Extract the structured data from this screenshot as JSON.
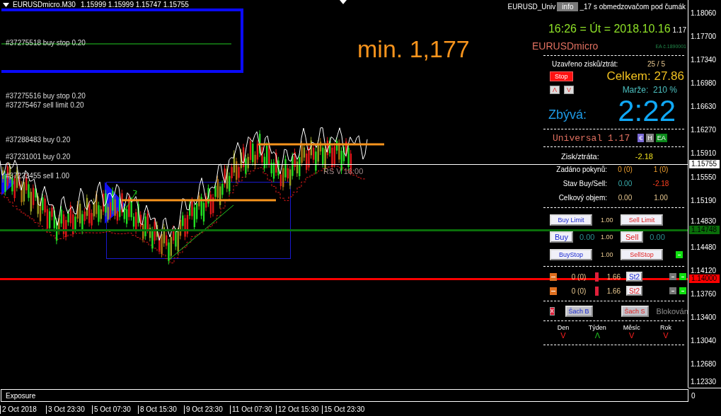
{
  "chart_header": {
    "symbol": "EURUSDmicro.M30",
    "prices": "1.15999 1.15999 1.15747 1.15755"
  },
  "order_labels": [
    {
      "text": "#37275518 buy stop 0.20"
    },
    {
      "text": "#37275516 buy stop 0.20"
    },
    {
      "text": "#37275467 sell limit 0.20"
    },
    {
      "text": "#37288483 buy 0.20"
    },
    {
      "text": "#37231001 buy 0.20"
    },
    {
      "text": "#37223455 sell 1.00"
    }
  ],
  "annotation": "min. 1,177",
  "signal_label": "RS V 16:00",
  "panel": {
    "title_left": "EURUSD_Univ",
    "info_button": "info",
    "title_right": "_17 s obmedzovačom pod čumák",
    "datetime": "16:26 = Út = 2018.10.16",
    "version_small": "1.17",
    "symbol": "EURUSDmicro",
    "ea_number": "EA č.1890001",
    "closed_label": "Uzavřeno zisků/ztrát:",
    "closed_value": "25 / 5",
    "stop_button": "Stop",
    "total": "Celkem: 27.86",
    "up_button": "Λ",
    "down_button": "V",
    "margin": "Marže:  210 %",
    "remaining_label": "Zbývá:",
    "remaining_time": "2:22",
    "product": "Universal 1.17",
    "badges": [
      {
        "text": "€",
        "color": "#7a6ad6"
      },
      {
        "text": "H",
        "color": "#808080"
      },
      {
        "text": "EA",
        "color": "#0c8a1c"
      }
    ],
    "profit_label": "Zisk/ztráta:",
    "profit_value": "-2.18",
    "stats": [
      {
        "label": "Zadáno pokynů:",
        "buy": "0 (0)",
        "sell": "1 (0)",
        "kind": "orders"
      },
      {
        "label": "Stav Buy/Sell:",
        "buy": "0.00",
        "sell": "-2.18",
        "kind": "state"
      },
      {
        "label": "Celkový objem:",
        "buy": "0.00",
        "sell": "1.00",
        "kind": "volume"
      }
    ],
    "order_rows": [
      {
        "buy": "Buy Limit",
        "lot": "1.00",
        "sell": "Sell Limit"
      },
      {
        "buy": "Buy",
        "buy_value": "0.00",
        "lot": "1.00",
        "sell": "Sell",
        "sell_value": "0.00"
      },
      {
        "buy": "BuyStop",
        "lot": "1.00",
        "sell": "SellStop",
        "toggle": true
      }
    ],
    "stop_rows": [
      {
        "count": "0 (0)",
        "value": "1.66",
        "button": "St2",
        "kind": "buy",
        "switches": [
          false,
          true
        ]
      },
      {
        "count": "0 (0)",
        "value": "1.66",
        "button": "St2",
        "kind": "sell",
        "switches": [
          false,
          true
        ]
      }
    ],
    "hedge_row": {
      "close_button": "x",
      "buy": "Šach B",
      "sell": "Šach S",
      "status": "Blokován"
    },
    "periods": [
      {
        "label": "Den",
        "arrow": "V",
        "kind": "down"
      },
      {
        "label": "Týden",
        "arrow": "Λ",
        "kind": "up"
      },
      {
        "label": "Měsíc",
        "arrow": "V",
        "kind": "down"
      },
      {
        "label": "Rok",
        "arrow": "V",
        "kind": "down"
      }
    ]
  },
  "price_axis": {
    "ticks": [
      "1.18060",
      "1.17700",
      "1.17340",
      "1.16980",
      "1.16630",
      "1.16270",
      "1.15910",
      "1.15550",
      "1.15190",
      "1.14830",
      "1.14480",
      "1.14120",
      "1.13760",
      "1.13400",
      "1.13040",
      "1.12680",
      "1.12330"
    ],
    "markers": [
      {
        "label": "1.15755",
        "kind": "bid"
      },
      {
        "label": "1.14748",
        "kind": "level",
        "color": "#0a6e0a"
      },
      {
        "label": "1.14000",
        "kind": "level",
        "color": "#ff0000"
      }
    ]
  },
  "subwindow": {
    "title": "Exposure",
    "scale": "0"
  },
  "time_axis": [
    "2 Oct 2018",
    "3 Oct 23:30",
    "5 Oct 07:30",
    "8 Oct 15:30",
    "9 Oct 23:30",
    "11 Oct 07:30",
    "12 Oct 15:30",
    "15 Oct 23:30"
  ]
}
